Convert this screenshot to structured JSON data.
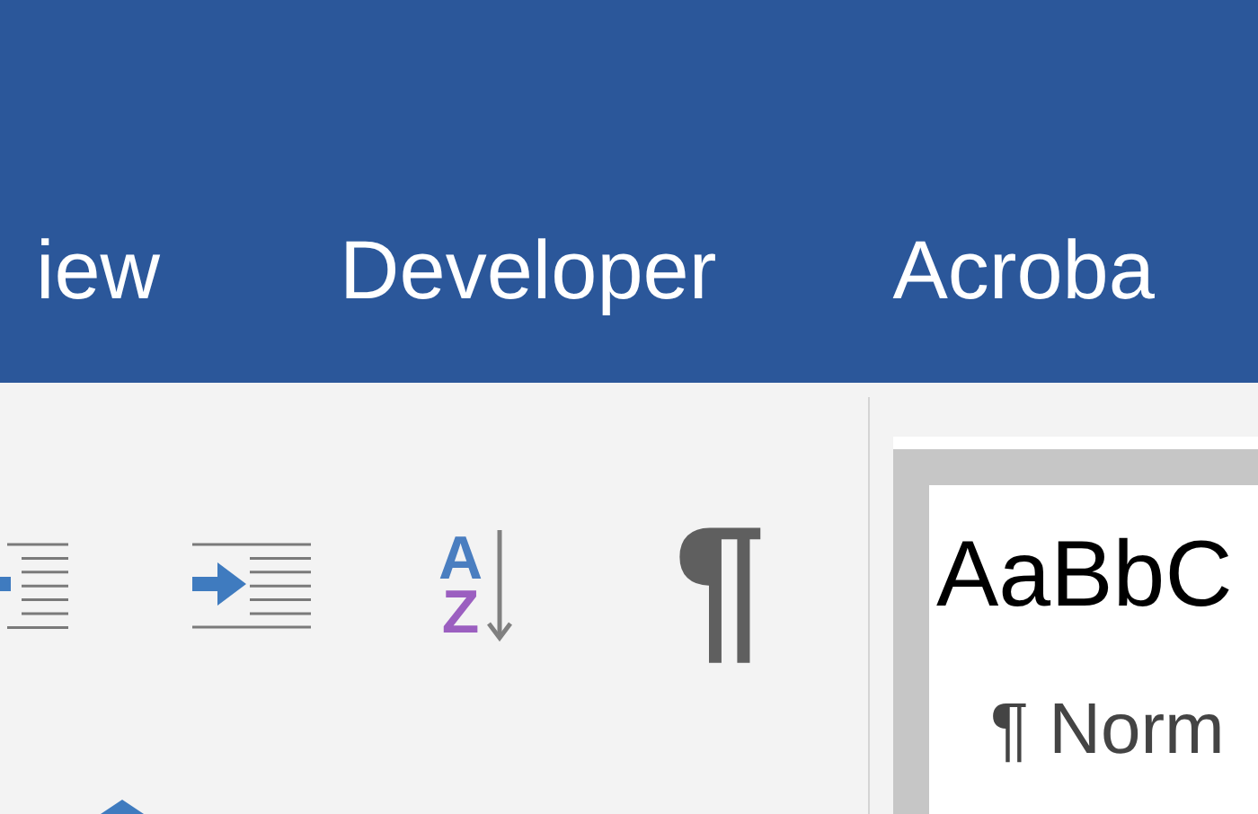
{
  "tabs": [
    {
      "label": "iew",
      "selected": false
    },
    {
      "label": "Developer",
      "selected": false
    },
    {
      "label": "Acroba",
      "selected": false
    }
  ],
  "sort_button": {
    "letters": [
      "A",
      "Z"
    ]
  },
  "show_marks_button": {
    "symbol": "¶",
    "on": false
  },
  "style_gallery": {
    "sample": "AaBbC",
    "name": "¶ Norm"
  }
}
